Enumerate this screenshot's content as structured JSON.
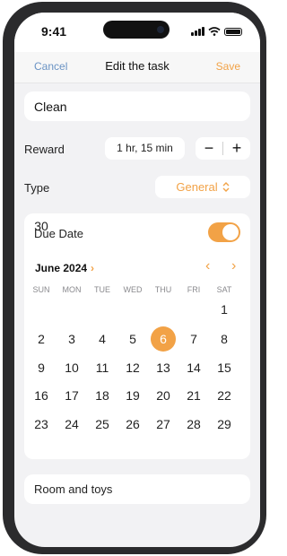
{
  "status_bar": {
    "time": "9:41"
  },
  "nav": {
    "cancel": "Cancel",
    "title": "Edit the task",
    "save": "Save"
  },
  "task": {
    "name": "Clean"
  },
  "reward": {
    "label": "Reward",
    "value": "1 hr, 15 min",
    "minus": "−",
    "plus": "+"
  },
  "type": {
    "label": "Type",
    "value": "General",
    "chevron": "⌃⌄"
  },
  "due": {
    "label": "Due Date",
    "enabled": true
  },
  "calendar": {
    "month": "June 2024",
    "month_chevron": "›",
    "prev": "‹",
    "next": "›",
    "weekdays": [
      "SUN",
      "MON",
      "TUE",
      "WED",
      "THU",
      "FRI",
      "SAT"
    ],
    "first_weekday": 6,
    "days_in_month": 30,
    "selected": 6
  },
  "notes": {
    "value": "Room and toys"
  },
  "colors": {
    "accent": "#f2a246",
    "link": "#6a93c4"
  }
}
